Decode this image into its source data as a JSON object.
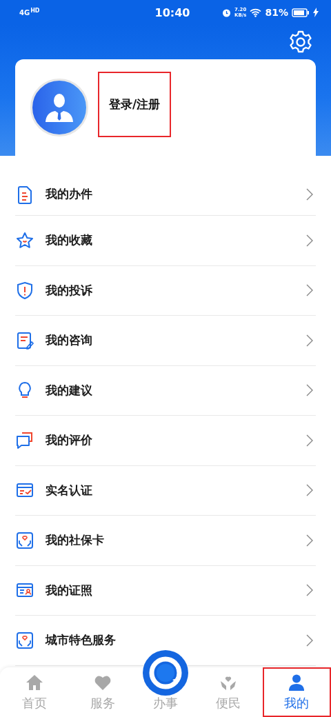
{
  "status_bar": {
    "network": "4G",
    "network_badge": "HD",
    "time": "10:40",
    "speed": "7.20",
    "speed_unit": "KB/s",
    "battery": "81%"
  },
  "profile": {
    "login_label": "登录/注册",
    "highlighted": true
  },
  "menu": [
    {
      "label": "我的办件",
      "kind": "document"
    },
    {
      "label": "我的收藏",
      "kind": "star"
    },
    {
      "label": "我的投诉",
      "kind": "shield"
    },
    {
      "label": "我的咨询",
      "kind": "edit"
    },
    {
      "label": "我的建议",
      "kind": "bulb"
    },
    {
      "label": "我的评价",
      "kind": "chat"
    },
    {
      "label": "实名认证",
      "kind": "idcard"
    },
    {
      "label": "我的社保卡",
      "kind": "care"
    },
    {
      "label": "我的证照",
      "kind": "license"
    },
    {
      "label": "城市特色服务",
      "kind": "care"
    }
  ],
  "tab_bar": [
    {
      "label": "首页",
      "kind": "home",
      "selected": false,
      "highlighted": false
    },
    {
      "label": "服务",
      "kind": "heart",
      "selected": false,
      "highlighted": false
    },
    {
      "label": "办事",
      "kind": "center",
      "selected": false,
      "highlighted": false
    },
    {
      "label": "便民",
      "kind": "hands",
      "selected": false,
      "highlighted": false
    },
    {
      "label": "我的",
      "kind": "person",
      "selected": true,
      "highlighted": true
    }
  ]
}
